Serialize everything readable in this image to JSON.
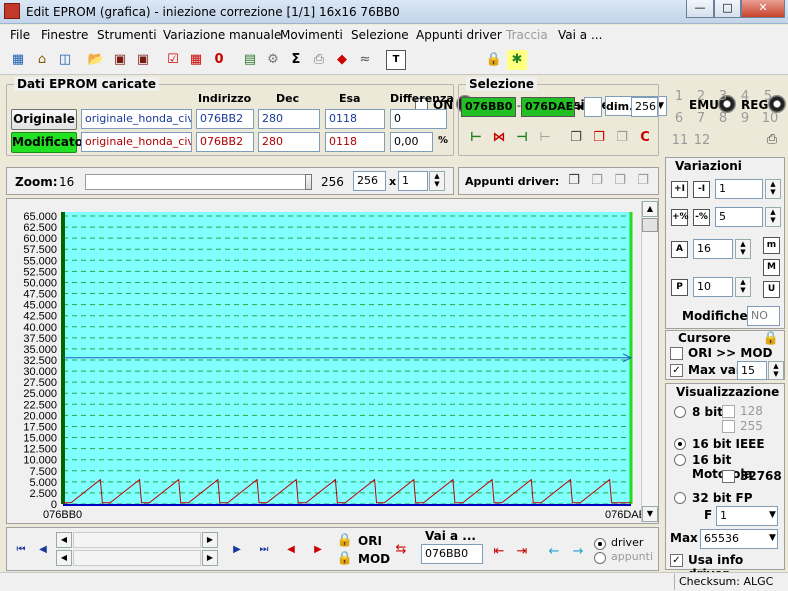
{
  "window": {
    "title": "Edit EPROM (grafica) - iniezione correzione  [1/1]  16x16  76BB0"
  },
  "menu": [
    "File",
    "Finestre",
    "Strumenti",
    "Variazione manuale",
    "Movimenti",
    "Selezione",
    "Appunti driver",
    "Traccia",
    "Vai a ..."
  ],
  "toolbar": {
    "on_label": "ON",
    "scansione_label": "Scansione",
    "emu_label": "EMU",
    "reg_label": "REG"
  },
  "dati": {
    "title": "Dati EPROM caricate",
    "headers": [
      "Indirizzo",
      "Dec",
      "Esa",
      "Differenza"
    ],
    "rows": [
      {
        "button": "Originale",
        "file": "originale_honda_civic.",
        "indirizzo": "076BB2",
        "dec": "280",
        "esa": "0118",
        "diff": "0"
      },
      {
        "button": "Modificato",
        "file": "originale_honda_civic.",
        "indirizzo": "076BB2",
        "dec": "280",
        "esa": "0118",
        "diff": "0,00",
        "unit": "%"
      }
    ]
  },
  "selezione": {
    "title": "Selezione",
    "from": "076BB0",
    "to": "076DAE",
    "x_label": "x",
    "dim_label": "dim.",
    "dim": "256"
  },
  "numpad": [
    "1",
    "2",
    "3",
    "4",
    "5",
    "6",
    "7",
    "8",
    "9",
    "10",
    "11",
    "12"
  ],
  "zoom": {
    "label": "Zoom:",
    "min": "16",
    "max": "256",
    "value": "256",
    "x_label": "x",
    "mult": "1"
  },
  "appunti": {
    "label": "Appunti driver:"
  },
  "variazioni": {
    "title": "Variazioni",
    "v1": "1",
    "v2": "5",
    "v3": "16",
    "v4": "10",
    "modifiche_label": "Modifiche:",
    "modifiche": "NO"
  },
  "cursore": {
    "title": "Cursore",
    "ori_mod": "ORI >> MOD",
    "maxvar_label": "Max var",
    "maxvar": "15"
  },
  "visual": {
    "title": "Visualizzazione",
    "b8": "8 bit",
    "v128": "128",
    "v255": "255",
    "ieee": "16 bit IEEE",
    "motorola": "16 bit Motorola",
    "v32768": "32768",
    "fp": "32 bit FP",
    "f_label": "F",
    "f_value": "1",
    "max_label": "Max",
    "max_value": "65536",
    "usa_info": "Usa info driver"
  },
  "bottom": {
    "ori": "ORI",
    "mod": "MOD",
    "vai_label": "Vai a ...",
    "vai_value": "076BB0",
    "driver": "driver",
    "appunti": "appunti"
  },
  "status": {
    "checksum": "Checksum: ALGC"
  },
  "chart_data": {
    "type": "line",
    "ylim": [
      0,
      65000
    ],
    "yticks": [
      "0",
      "2.500",
      "5.000",
      "7.500",
      "10.000",
      "12.500",
      "15.000",
      "17.500",
      "20.000",
      "22.500",
      "25.000",
      "27.500",
      "30.000",
      "32.500",
      "35.000",
      "37.500",
      "40.000",
      "42.500",
      "45.000",
      "47.500",
      "50.000",
      "52.500",
      "55.000",
      "57.500",
      "60.000",
      "62.500",
      "65.000"
    ],
    "x_start_label": "076BB0",
    "x_end_label": "076DAE",
    "cursor_value": 33000,
    "series": [
      {
        "teeth": 14,
        "low": 280,
        "high": 5500
      }
    ],
    "colors": {
      "bg": "#80ffff",
      "line": "#c00000",
      "grid": "#2aa84a",
      "cursor": "#1f5fbf"
    }
  }
}
